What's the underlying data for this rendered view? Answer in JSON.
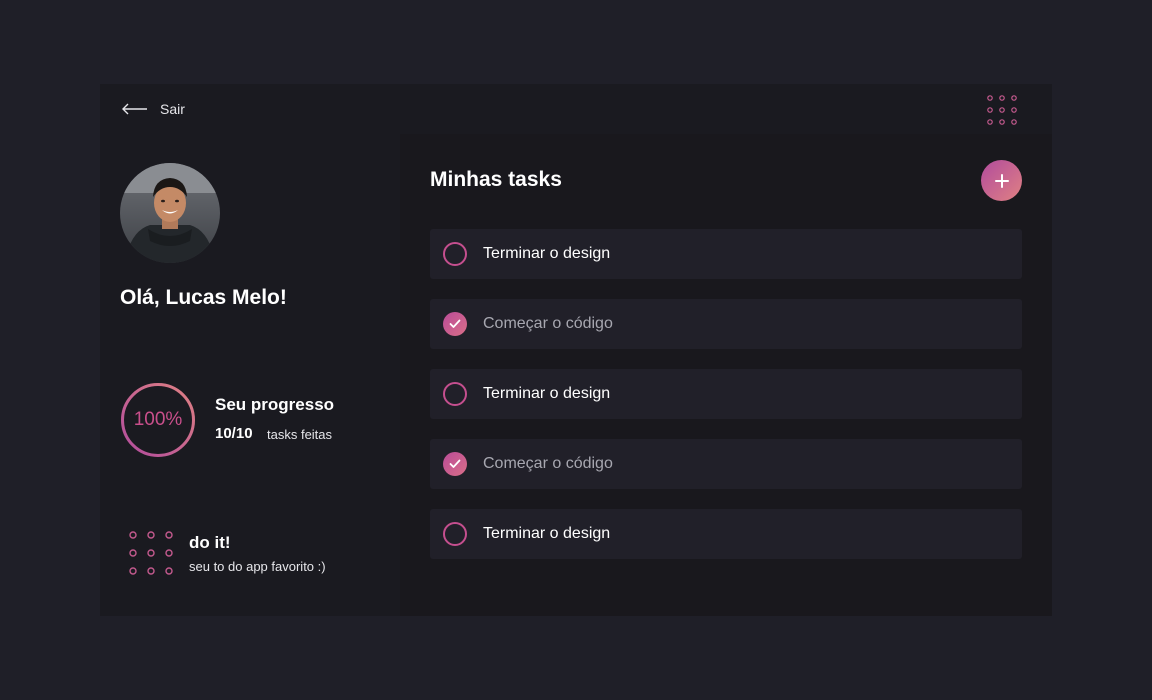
{
  "topbar": {
    "back_icon": "arrow-left-icon",
    "back_label": "Sair",
    "menu_icon": "dots-grid-icon"
  },
  "profile": {
    "avatar_alt": "Lucas Melo",
    "greeting": "Olá, Lucas Melo!"
  },
  "progress": {
    "percent_label": "100%",
    "percent": 100,
    "title": "Seu progresso",
    "count": "10/10",
    "suffix": "tasks feitas"
  },
  "brand": {
    "icon": "dots-grid-icon",
    "name": "do it!",
    "tagline": "seu to do app favorito :)"
  },
  "tasks": {
    "title": "Minhas tasks",
    "add_icon": "plus-icon",
    "items": [
      {
        "label": "Terminar o design",
        "done": false
      },
      {
        "label": "Começar o código",
        "done": true
      },
      {
        "label": "Terminar o design",
        "done": false
      },
      {
        "label": "Começar o código",
        "done": true
      },
      {
        "label": "Terminar o design",
        "done": false
      }
    ]
  },
  "colors": {
    "background": "#1f1f28",
    "panel": "#1a1a20",
    "main_panel": "#19181d",
    "task_row": "#212029",
    "accent_start": "#b14b9d",
    "accent_end": "#e08183",
    "text": "#ffffff",
    "muted_text": "#a7a7b0"
  }
}
